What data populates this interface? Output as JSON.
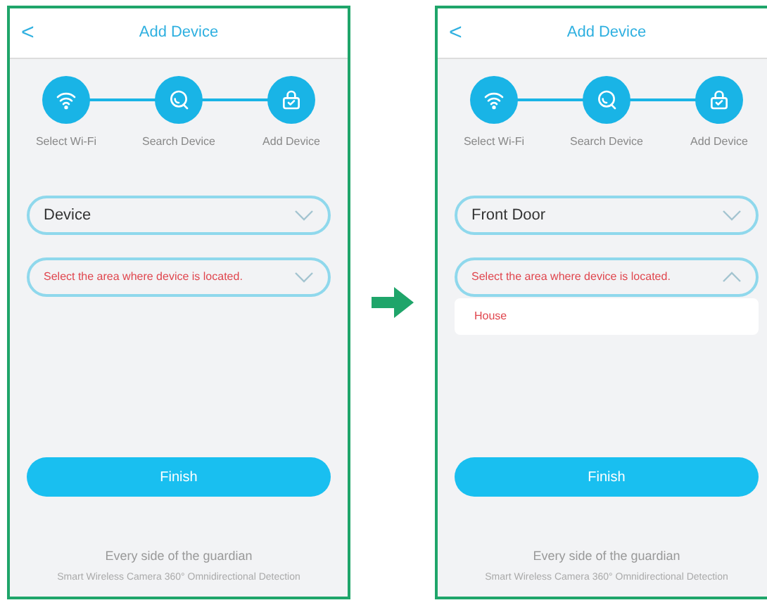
{
  "screens": [
    {
      "header": {
        "back": "<",
        "title": "Add Device"
      },
      "steps": [
        {
          "label": "Select Wi-Fi",
          "kind": "wifi"
        },
        {
          "label": "Search Device",
          "kind": "search"
        },
        {
          "label": "Add Device",
          "kind": "lock"
        }
      ],
      "fields": [
        {
          "value": "Device",
          "expanded": false
        },
        {
          "prompt": "Select the area where device is located.",
          "expanded": false
        }
      ],
      "button": "Finish",
      "footer": [
        "Every side of the guardian",
        "Smart Wireless Camera 360° Omnidirectional Detection"
      ]
    },
    {
      "header": {
        "back": "<",
        "title": "Add Device"
      },
      "steps": [
        {
          "label": "Select Wi-Fi",
          "kind": "wifi"
        },
        {
          "label": "Search Device",
          "kind": "search"
        },
        {
          "label": "Add Device",
          "kind": "lock"
        }
      ],
      "fields": [
        {
          "value": "Front Door",
          "expanded": false
        },
        {
          "prompt": "Select the area where device is located.",
          "expanded": true,
          "options": [
            "House"
          ]
        }
      ],
      "button": "Finish",
      "footer": [
        "Every side of the guardian",
        "Smart Wireless Camera 360° Omnidirectional Detection"
      ]
    }
  ]
}
